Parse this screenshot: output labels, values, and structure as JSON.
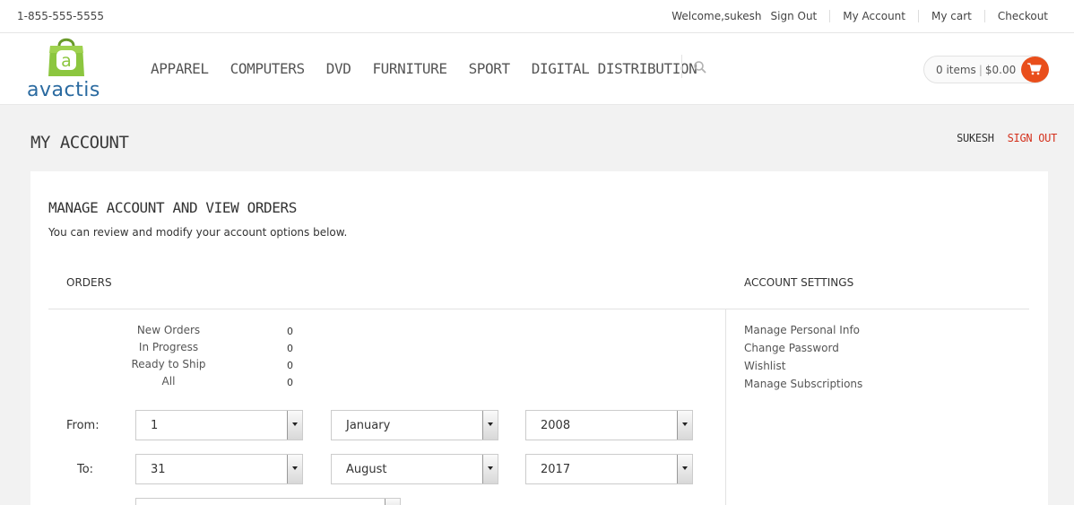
{
  "topbar": {
    "phone": "1-855-555-5555",
    "welcome": "Welcome,sukesh",
    "links": [
      "Sign Out",
      "My Account",
      "My cart",
      "Checkout"
    ]
  },
  "logo": {
    "text": "avactis",
    "brand_color": "#2a6aa0",
    "bag_color": "#8cc63f"
  },
  "nav": {
    "items": [
      "APPAREL",
      "COMPUTERS",
      "DVD",
      "FURNITURE",
      "SPORT",
      "DIGITAL DISTRIBUTION"
    ]
  },
  "cart": {
    "items": "0 items",
    "total": "$0.00",
    "accent": "#e94e1b",
    "icon": "cart-icon"
  },
  "page": {
    "title": "MY ACCOUNT",
    "username": "SUKESH",
    "signout": "SIGN OUT"
  },
  "panel": {
    "title": "MANAGE ACCOUNT AND VIEW ORDERS",
    "subtitle": "You can review and modify your account options below.",
    "orders_heading": "ORDERS",
    "settings_heading": "ACCOUNT SETTINGS",
    "stats": [
      {
        "label": "New Orders",
        "value": "0"
      },
      {
        "label": "In Progress",
        "value": "0"
      },
      {
        "label": "Ready to Ship",
        "value": "0"
      },
      {
        "label": "All",
        "value": "0"
      }
    ],
    "from_label": "From:",
    "to_label": "To:",
    "from": {
      "day": "1",
      "month": "January",
      "year": "2008"
    },
    "to": {
      "day": "31",
      "month": "August",
      "year": "2017"
    },
    "settings_links": [
      "Manage Personal Info",
      "Change Password",
      "Wishlist",
      "Manage Subscriptions"
    ]
  }
}
